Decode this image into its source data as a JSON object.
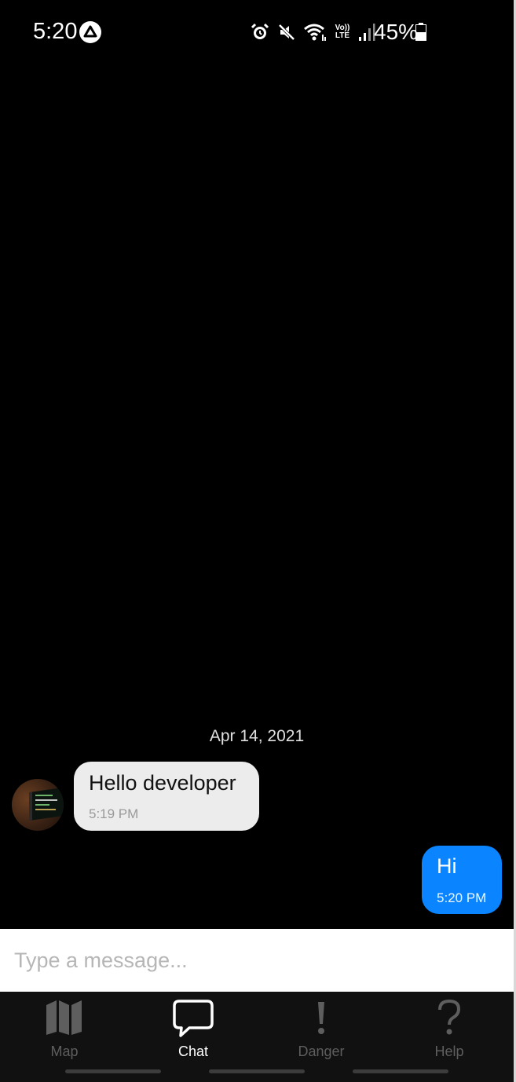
{
  "status_bar": {
    "time": "5:20",
    "volte_top": "Vo))",
    "volte_bottom": "LTE",
    "battery": "45%",
    "icons": [
      "react-app-icon",
      "alarm-icon",
      "mute-icon",
      "wifi-icon",
      "volte-icon",
      "signal-icon",
      "battery-icon"
    ]
  },
  "chat": {
    "date_separator": "Apr 14, 2021",
    "messages": [
      {
        "direction": "incoming",
        "text": "Hello developer",
        "time": "5:19 PM",
        "avatar": "avatar-developer"
      },
      {
        "direction": "outgoing",
        "text": "Hi",
        "time": "5:20 PM"
      }
    ]
  },
  "composer": {
    "placeholder": "Type a message...",
    "value": ""
  },
  "tabs": [
    {
      "label": "Map",
      "icon": "map-icon",
      "active": false
    },
    {
      "label": "Chat",
      "icon": "chat-bubble-icon",
      "active": true
    },
    {
      "label": "Danger",
      "icon": "exclamation-icon",
      "active": false
    },
    {
      "label": "Help",
      "icon": "question-icon",
      "active": false
    }
  ],
  "colors": {
    "background": "#000000",
    "incoming_bubble": "#ececec",
    "outgoing_bubble": "#0a84ff",
    "tab_bar": "#111111",
    "tab_active": "#ffffff",
    "tab_inactive": "#5e5e5e"
  }
}
